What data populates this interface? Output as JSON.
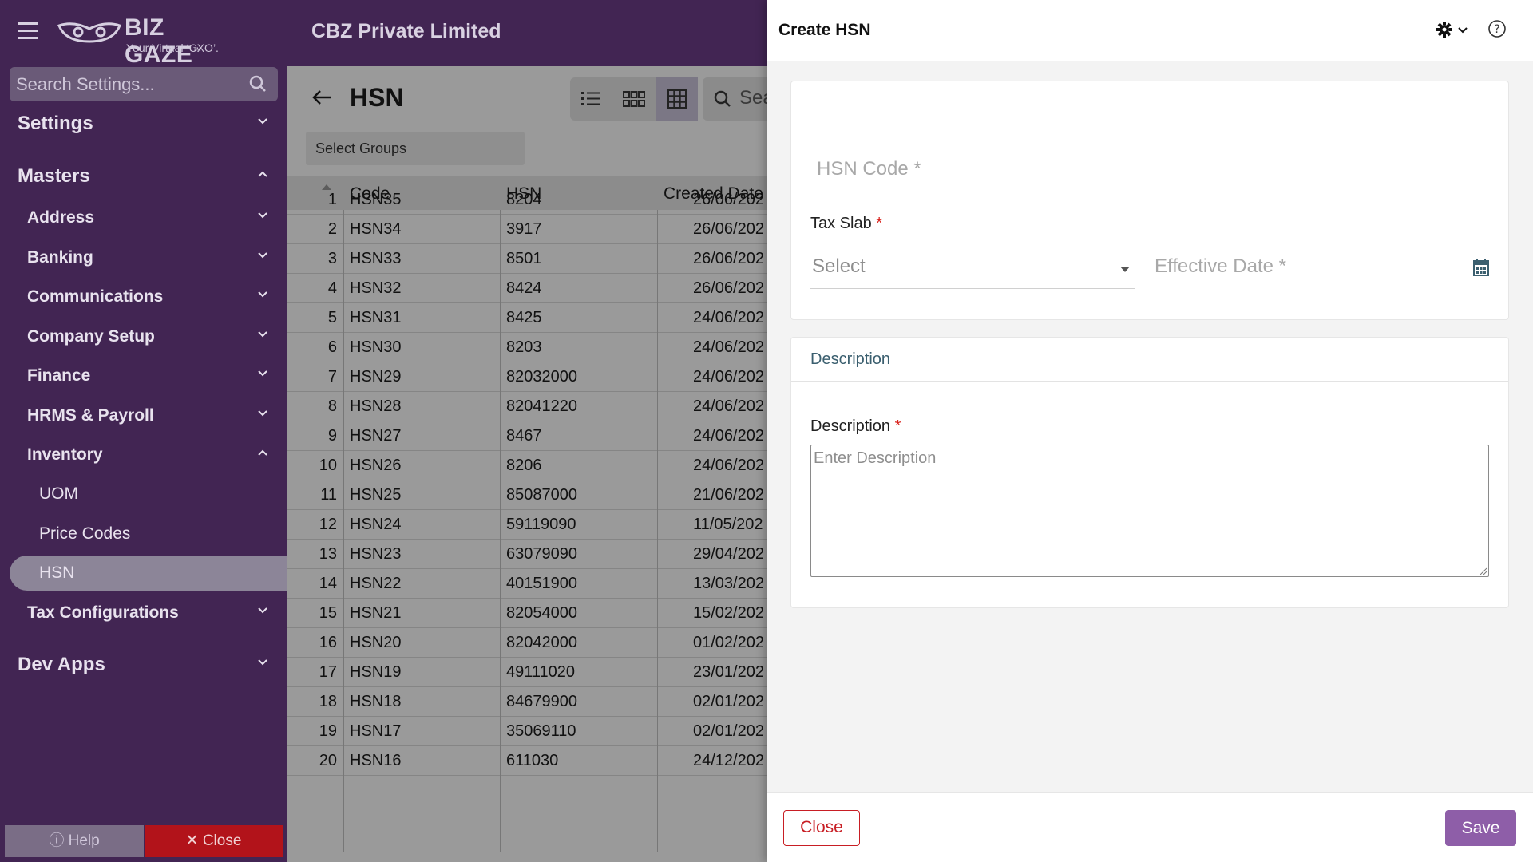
{
  "header": {
    "company": "CBZ Private Limited",
    "logo_brand": "BIZ GAZE",
    "logo_tm": "™",
    "logo_tagline": "Your Virtual ‘CXO’."
  },
  "sidebar": {
    "search_placeholder": "Search Settings...",
    "items": [
      {
        "label": "Settings",
        "level": 0,
        "chevron": "down"
      },
      {
        "label": "Masters",
        "level": 0,
        "chevron": "up"
      },
      {
        "label": "Address",
        "level": 1,
        "chevron": "down"
      },
      {
        "label": "Banking",
        "level": 1,
        "chevron": "down"
      },
      {
        "label": "Communications",
        "level": 1,
        "chevron": "down"
      },
      {
        "label": "Company Setup",
        "level": 1,
        "chevron": "down"
      },
      {
        "label": "Finance",
        "level": 1,
        "chevron": "down"
      },
      {
        "label": "HRMS & Payroll",
        "level": 1,
        "chevron": "down"
      },
      {
        "label": "Inventory",
        "level": 1,
        "chevron": "up"
      },
      {
        "label": "UOM",
        "level": 2
      },
      {
        "label": "Price Codes",
        "level": 2
      },
      {
        "label": "HSN",
        "level": 2,
        "active": true
      },
      {
        "label": "Tax Configurations",
        "level": 1,
        "chevron": "down"
      },
      {
        "label": "Dev Apps",
        "level": 0,
        "chevron": "down"
      }
    ],
    "help_label": "Help",
    "close_label": "Close"
  },
  "list": {
    "title": "HSN",
    "search_placeholder": "Sea",
    "group_select": "Select Groups",
    "columns": [
      "Code",
      "HSN",
      "Created Date"
    ],
    "rows": [
      {
        "n": "1",
        "code": "HSN35",
        "hsn": "8204",
        "date": "26/06/202"
      },
      {
        "n": "2",
        "code": "HSN34",
        "hsn": "3917",
        "date": "26/06/202"
      },
      {
        "n": "3",
        "code": "HSN33",
        "hsn": "8501",
        "date": "26/06/202"
      },
      {
        "n": "4",
        "code": "HSN32",
        "hsn": "8424",
        "date": "26/06/202"
      },
      {
        "n": "5",
        "code": "HSN31",
        "hsn": "8425",
        "date": "24/06/202"
      },
      {
        "n": "6",
        "code": "HSN30",
        "hsn": "8203",
        "date": "24/06/202"
      },
      {
        "n": "7",
        "code": "HSN29",
        "hsn": "82032000",
        "date": "24/06/202"
      },
      {
        "n": "8",
        "code": "HSN28",
        "hsn": "82041220",
        "date": "24/06/202"
      },
      {
        "n": "9",
        "code": "HSN27",
        "hsn": "8467",
        "date": "24/06/202"
      },
      {
        "n": "10",
        "code": "HSN26",
        "hsn": "8206",
        "date": "24/06/202"
      },
      {
        "n": "11",
        "code": "HSN25",
        "hsn": "85087000",
        "date": "21/06/202"
      },
      {
        "n": "12",
        "code": "HSN24",
        "hsn": "59119090",
        "date": "11/05/202"
      },
      {
        "n": "13",
        "code": "HSN23",
        "hsn": "63079090",
        "date": "29/04/202"
      },
      {
        "n": "14",
        "code": "HSN22",
        "hsn": "40151900",
        "date": "13/03/202"
      },
      {
        "n": "15",
        "code": "HSN21",
        "hsn": "82054000",
        "date": "15/02/202"
      },
      {
        "n": "16",
        "code": "HSN20",
        "hsn": "82042000",
        "date": "01/02/202"
      },
      {
        "n": "17",
        "code": "HSN19",
        "hsn": "49111020",
        "date": "23/01/202"
      },
      {
        "n": "18",
        "code": "HSN18",
        "hsn": "84679900",
        "date": "02/01/202"
      },
      {
        "n": "19",
        "code": "HSN17",
        "hsn": "35069110",
        "date": "02/01/202"
      },
      {
        "n": "20",
        "code": "HSN16",
        "hsn": "611030",
        "date": "24/12/202"
      }
    ]
  },
  "drawer": {
    "title": "Create HSN",
    "hsn_code_placeholder": "HSN Code *",
    "tax_slab_label": "Tax Slab",
    "required_mark": "*",
    "tax_slab_value": "Select",
    "effective_date_placeholder": "Effective Date *",
    "description_section": "Description",
    "description_label": "Description",
    "description_placeholder": "Enter Description",
    "close_label": "Close",
    "save_label": "Save"
  },
  "colors": {
    "sidebar_bg": "#422553",
    "save_button": "#8e5ea8",
    "close_red": "#c81e24",
    "required_red": "#d9231d"
  }
}
